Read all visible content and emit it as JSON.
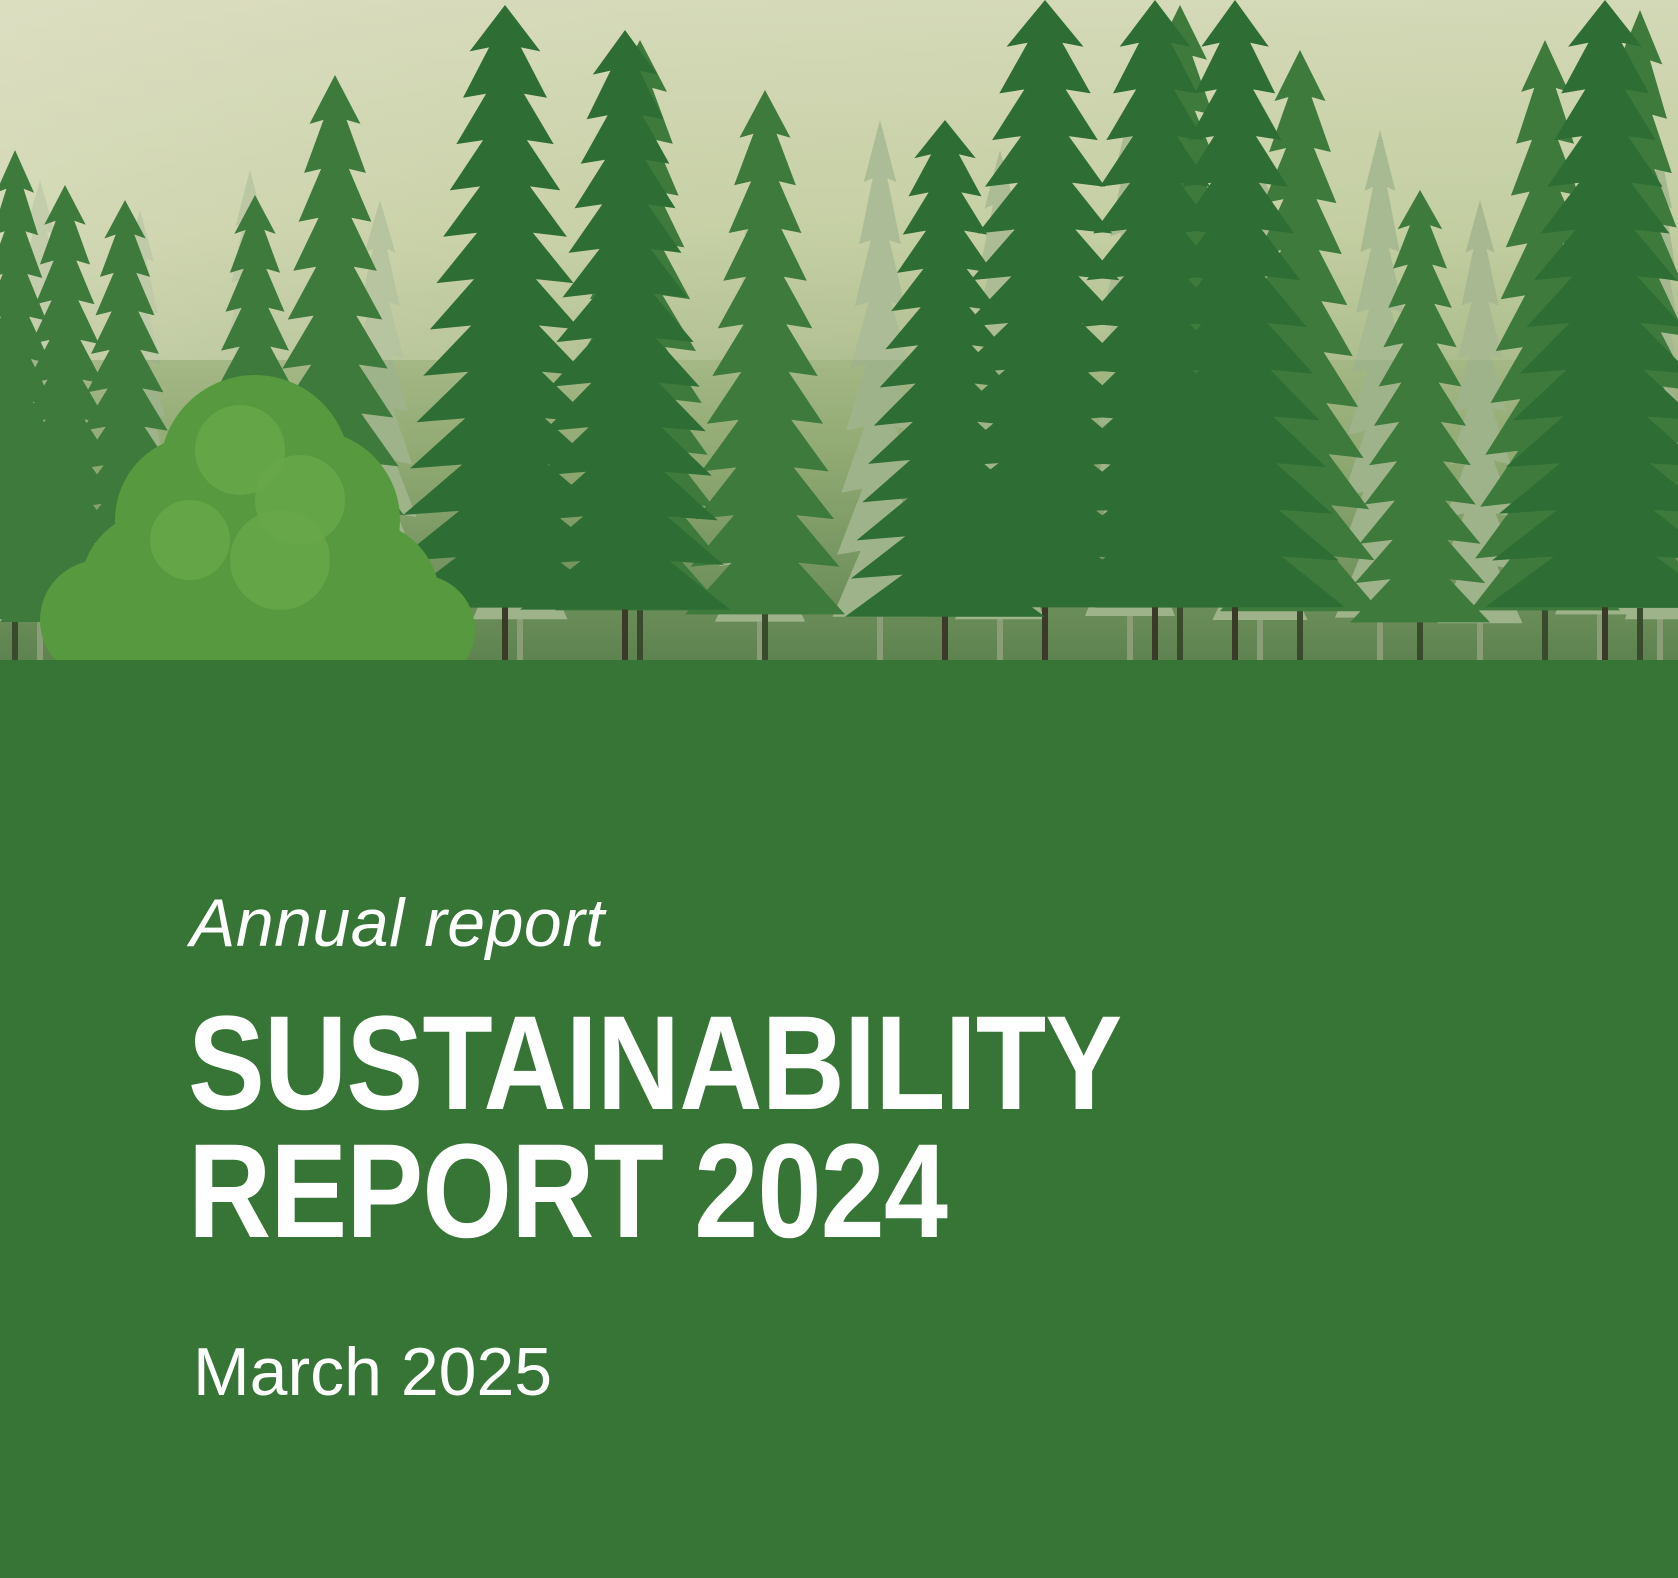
{
  "cover": {
    "subtitle": "Annual report",
    "title_line1": "SUSTAINABILITY",
    "title_line2": "REPORT 2024",
    "date": "March 2025"
  },
  "colors": {
    "panel_green": "#367536",
    "text": "#ffffff"
  },
  "image": {
    "subject": "misty conifer forest"
  }
}
